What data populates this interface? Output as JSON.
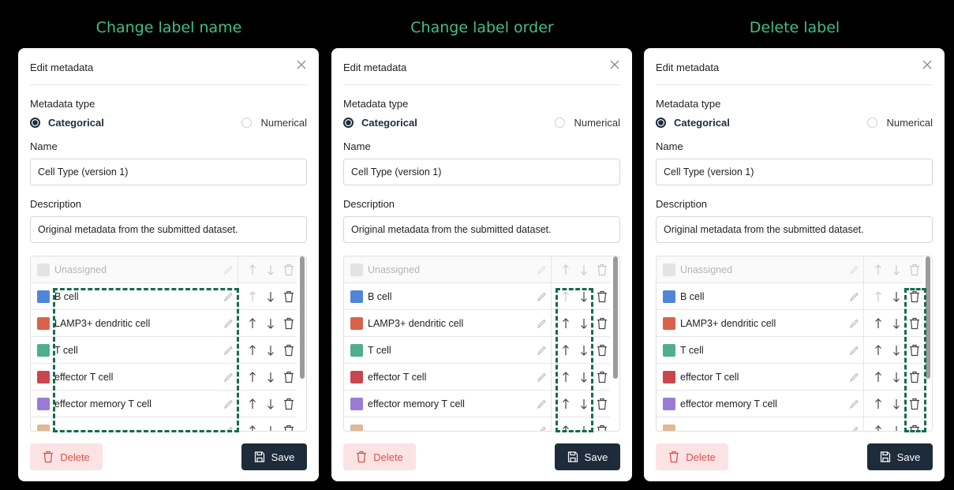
{
  "panels": [
    {
      "heading": "Change label name",
      "highlight": "names",
      "buttons_highlight": false
    },
    {
      "heading": "Change label order",
      "highlight": "order",
      "buttons_highlight": false
    },
    {
      "heading": "Delete label",
      "highlight": "delete",
      "buttons_highlight": false
    }
  ],
  "dialog": {
    "title": "Edit metadata",
    "close_icon": "close-icon",
    "metadata_type_label": "Metadata type",
    "type_options": [
      {
        "label": "Categorical",
        "selected": true
      },
      {
        "label": "Numerical",
        "selected": false
      }
    ],
    "name_label": "Name",
    "name_value": "Cell Type (version 1)",
    "description_label": "Description",
    "description_value": "Original metadata from the submitted dataset.",
    "labels_header": {
      "name": "Unassigned",
      "color": "#e3e3e3"
    },
    "labels": [
      {
        "name": "B cell",
        "color": "#4f86d9"
      },
      {
        "name": "LAMP3+ dendritic cell",
        "color": "#d9634a"
      },
      {
        "name": "T cell",
        "color": "#4fae8c"
      },
      {
        "name": "effector T cell",
        "color": "#c9464f"
      },
      {
        "name": "effector memory T cell",
        "color": "#9a7bd6"
      },
      {
        "name": "",
        "color": "#e0b894"
      }
    ],
    "delete_label": "Delete",
    "save_label": "Save"
  },
  "colors": {
    "accent_heading": "#3fbf8c",
    "highlight_dash": "#146b4a",
    "save_bg": "#1d2b3a",
    "delete_bg": "#fbe3e3",
    "delete_text": "#d9534f"
  }
}
